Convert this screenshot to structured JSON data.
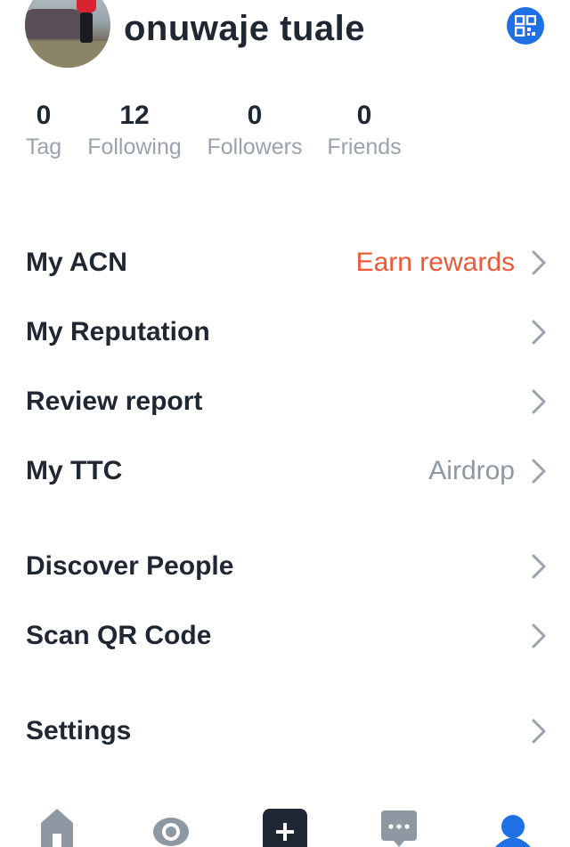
{
  "profile": {
    "username": "onuwaje tuale",
    "qr_icon": "qr-code-icon"
  },
  "stats": [
    {
      "value": "0",
      "label": "Tag"
    },
    {
      "value": "12",
      "label": "Following"
    },
    {
      "value": "0",
      "label": "Followers"
    },
    {
      "value": "0",
      "label": "Friends"
    }
  ],
  "menu": {
    "my_acn": {
      "label": "My ACN",
      "extra": "Earn rewards"
    },
    "my_reputation": {
      "label": "My Reputation"
    },
    "review_report": {
      "label": "Review report"
    },
    "my_ttc": {
      "label": "My TTC",
      "extra": "Airdrop"
    },
    "discover_people": {
      "label": "Discover People"
    },
    "scan_qr": {
      "label": "Scan QR Code"
    },
    "settings": {
      "label": "Settings"
    }
  },
  "colors": {
    "accent_blue": "#1f6fe5",
    "reward_orange": "#ea5a34",
    "text_dark": "#1f2733",
    "text_gray": "#9aa3ad"
  },
  "tabbar": {
    "icons": [
      "home-icon",
      "eye-icon",
      "plus-icon",
      "chat-icon",
      "profile-icon"
    ]
  }
}
